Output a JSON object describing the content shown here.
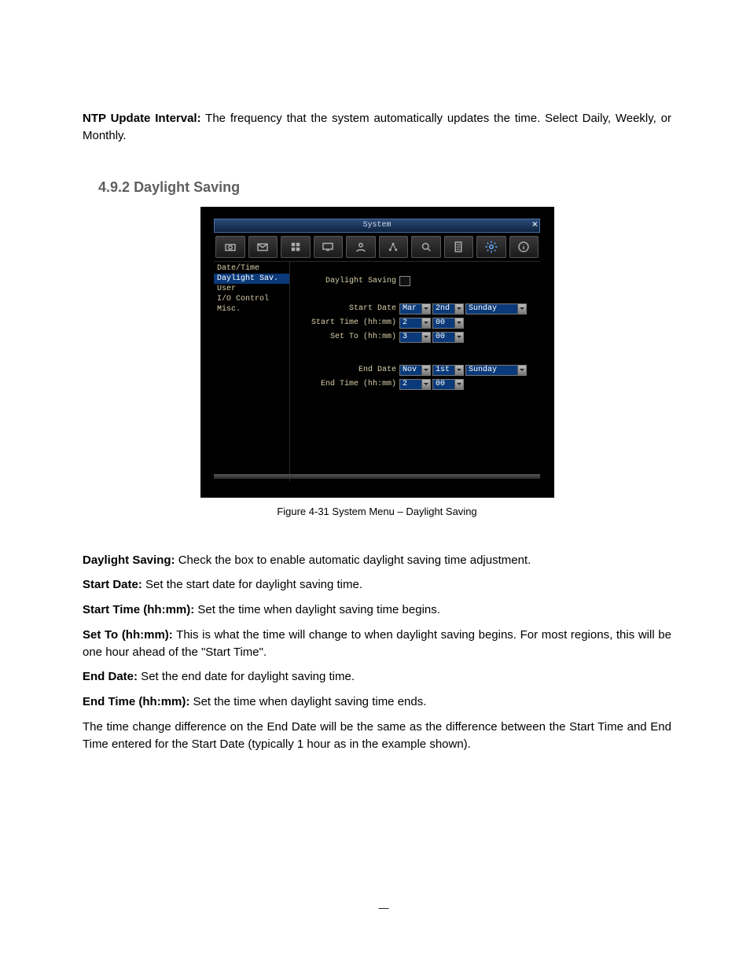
{
  "intro": {
    "label": "NTP Update Interval:",
    "text": " The frequency that the system automatically updates the time. Select Daily, Weekly, or Monthly."
  },
  "section": {
    "number": "4.9.2",
    "title": "Daylight Saving"
  },
  "screenshot": {
    "title": "System",
    "close": "×",
    "sidebar": [
      {
        "label": "Date/Time",
        "sel": false
      },
      {
        "label": "Daylight Sav.",
        "sel": true
      },
      {
        "label": "User",
        "sel": false
      },
      {
        "label": "I/O Control",
        "sel": false
      },
      {
        "label": "Misc.",
        "sel": false
      }
    ],
    "dst_label": "Daylight Saving",
    "rows": {
      "start_date": {
        "label": "Start Date",
        "month": "Mar",
        "ord": "2nd",
        "day": "Sunday"
      },
      "start_time": {
        "label": "Start Time (hh:mm)",
        "hh": "2",
        "mm": "00"
      },
      "set_to": {
        "label": "Set To (hh:mm)",
        "hh": "3",
        "mm": "00"
      },
      "end_date": {
        "label": "End Date",
        "month": "Nov",
        "ord": "1st",
        "day": "Sunday"
      },
      "end_time": {
        "label": "End Time (hh:mm)",
        "hh": "2",
        "mm": "00"
      }
    }
  },
  "caption": "Figure 4-31   System Menu – Daylight Saving",
  "defs": [
    {
      "label": "Daylight Saving:",
      "text": " Check the box to enable automatic daylight saving time adjustment."
    },
    {
      "label": "Start Date:",
      "text": " Set the start date for daylight saving time."
    },
    {
      "label": "Start Time (hh:mm):",
      "text": " Set the time when daylight saving time begins."
    },
    {
      "label": "Set To (hh:mm):",
      "text": " This is what the time will change to when daylight saving begins. For most regions, this will be one hour ahead of the \"Start Time\"."
    },
    {
      "label": "End Date:",
      "text": " Set the end date for daylight saving time."
    },
    {
      "label": "End Time (hh:mm):",
      "text": " Set the time when daylight saving time ends."
    }
  ],
  "closing": "The time change difference on the End Date will be the same as the difference between the Start Time and End Time entered for the Start Date (typically 1 hour as in the example shown).",
  "pagenum": "—"
}
